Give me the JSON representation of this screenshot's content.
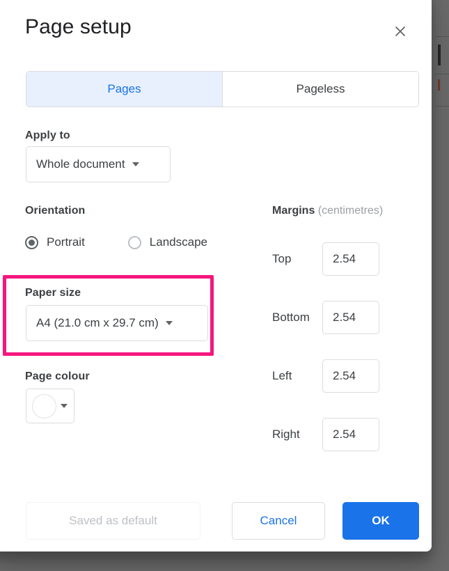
{
  "dialog": {
    "title": "Page setup",
    "close_icon": "close-icon"
  },
  "tabs": [
    {
      "label": "Pages",
      "active": true
    },
    {
      "label": "Pageless",
      "active": false
    }
  ],
  "apply_to": {
    "label": "Apply to",
    "value": "Whole document"
  },
  "orientation": {
    "label": "Orientation",
    "options": [
      {
        "label": "Portrait",
        "checked": true
      },
      {
        "label": "Landscape",
        "checked": false
      }
    ]
  },
  "paper_size": {
    "label": "Paper size",
    "value": "A4 (21.0 cm x 29.7 cm)",
    "highlighted": true,
    "highlight_colour": "#f5167e"
  },
  "page_colour": {
    "label": "Page colour",
    "swatch": "#ffffff"
  },
  "margins": {
    "title": "Margins",
    "unit": "(centimetres)",
    "fields": [
      {
        "label": "Top",
        "value": "2.54"
      },
      {
        "label": "Bottom",
        "value": "2.54"
      },
      {
        "label": "Left",
        "value": "2.54"
      },
      {
        "label": "Right",
        "value": "2.54"
      }
    ]
  },
  "footer": {
    "saved_as_default": "Saved as default",
    "cancel": "Cancel",
    "ok": "OK"
  },
  "colours": {
    "accent": "#1a73e8",
    "tab_active_bg": "#e8f0fe",
    "text": "#3c4043",
    "muted": "#9aa0a6"
  }
}
